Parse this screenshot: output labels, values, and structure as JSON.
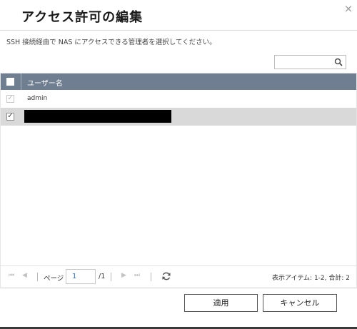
{
  "dialog": {
    "title": "アクセス許可の編集",
    "description": "SSH 接続経由で NAS にアクセスできる管理者を選択してください。",
    "close_glyph": "×"
  },
  "search": {
    "value": "",
    "placeholder": "",
    "icon": "search-icon"
  },
  "table": {
    "header": {
      "column_user": "ユーザー名",
      "select_all_checked": false
    },
    "rows": [
      {
        "checked": true,
        "disabled": true,
        "name": "admin",
        "selected": false
      },
      {
        "checked": true,
        "disabled": false,
        "name": "",
        "redacted": true,
        "selected": true
      }
    ]
  },
  "pager": {
    "first_glyph": "⏮",
    "prev_glyph": "◀",
    "next_glyph": "▶",
    "last_glyph": "⏭",
    "page_label": "ページ",
    "current_page": "1",
    "total_pages": "/1",
    "summary": "表示アイテム: 1-2, 合計: 2"
  },
  "buttons": {
    "apply": "適用",
    "cancel": "キャンセル"
  },
  "colors": {
    "header_bg": "#6f7e91",
    "selected_row_bg": "#d9d9d9",
    "page_number": "#2f6fb3"
  }
}
